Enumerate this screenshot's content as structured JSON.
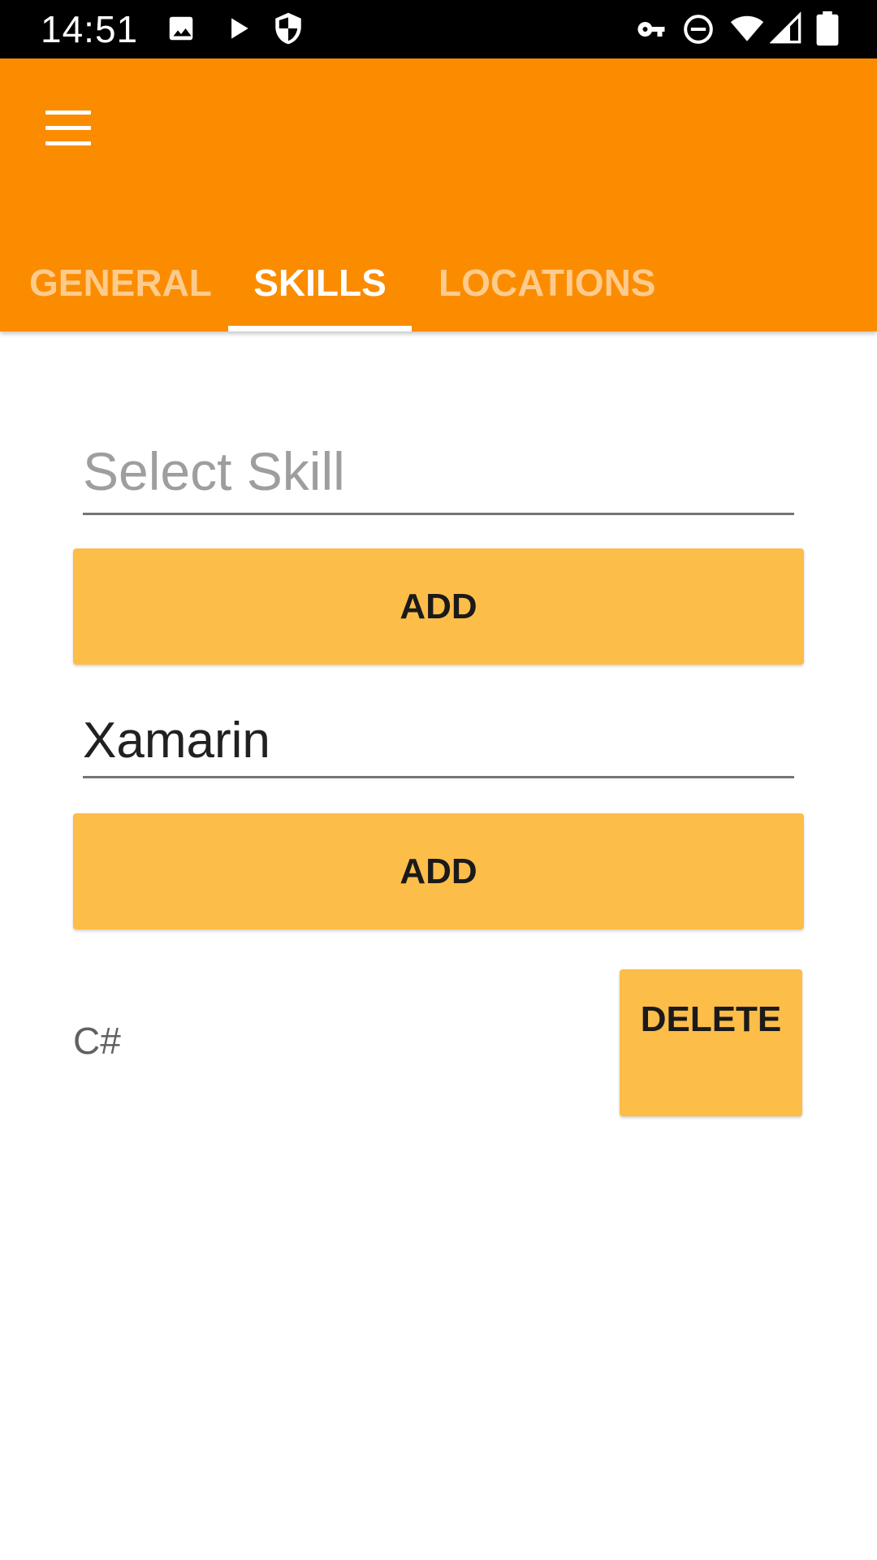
{
  "status_bar": {
    "time": "14:51",
    "left_icons": [
      "image-icon",
      "play-icon",
      "shield-icon"
    ],
    "right_icons": [
      "vpn-key-icon",
      "do-not-disturb-icon",
      "wifi-icon",
      "cell-signal-icon",
      "battery-icon"
    ]
  },
  "app_bar": {
    "menu_icon": "hamburger-menu-icon",
    "background_color": "#FB8C00"
  },
  "tabs": [
    {
      "label": "GENERAL",
      "active": false
    },
    {
      "label": "SKILLS",
      "active": true
    },
    {
      "label": "LOCATIONS",
      "active": false
    }
  ],
  "skill_picker": {
    "placeholder": "Select Skill",
    "add_label": "ADD"
  },
  "skill_entry": {
    "value": "Xamarin",
    "add_label": "ADD"
  },
  "skills_list": [
    {
      "name": "C#",
      "delete_label": "DELETE"
    }
  ],
  "colors": {
    "accent": "#FDBD49",
    "primary": "#FB8C00"
  }
}
